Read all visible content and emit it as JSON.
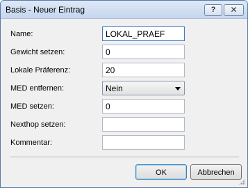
{
  "window": {
    "title": "Basis - Neuer Eintrag",
    "help_glyph": "?",
    "close_glyph": "✕"
  },
  "form": {
    "fields": [
      {
        "label": "Name:",
        "value": "LOKAL_PRAEF",
        "type": "text"
      },
      {
        "label": "Gewicht setzen:",
        "value": "0",
        "type": "text"
      },
      {
        "label": "Lokale Präferenz:",
        "value": "20",
        "type": "text"
      },
      {
        "label": "MED entfernen:",
        "value": "Nein",
        "type": "select"
      },
      {
        "label": "MED setzen:",
        "value": "0",
        "type": "text"
      },
      {
        "label": "Nexthop setzen:",
        "value": "",
        "type": "text"
      },
      {
        "label": "Kommentar:",
        "value": "",
        "type": "text"
      }
    ]
  },
  "buttons": {
    "ok": "OK",
    "cancel": "Abbrechen"
  },
  "colors": {
    "title_bar": "#c4d6ee",
    "dialog_bg": "#f0f0f0",
    "focus_border": "#3d7bc7"
  }
}
